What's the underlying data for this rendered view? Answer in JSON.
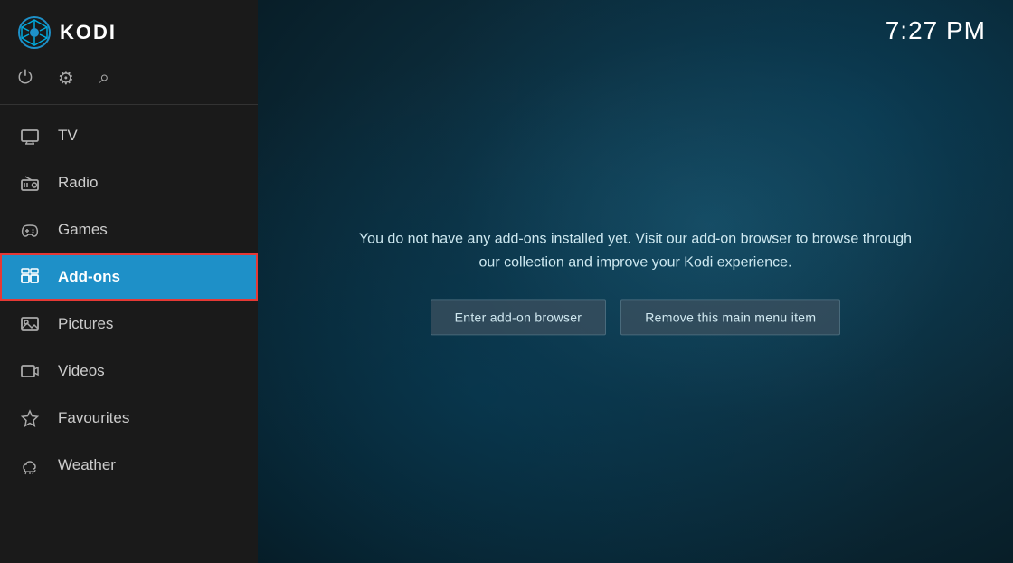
{
  "app": {
    "title": "KODI",
    "clock": "7:27 PM"
  },
  "sidebar": {
    "icons": [
      {
        "name": "power-icon",
        "symbol": "⏻",
        "label": "Power"
      },
      {
        "name": "settings-icon",
        "symbol": "⚙",
        "label": "Settings"
      },
      {
        "name": "search-icon",
        "symbol": "⌕",
        "label": "Search"
      }
    ],
    "nav_items": [
      {
        "id": "tv",
        "label": "TV",
        "icon": "tv-icon",
        "active": false
      },
      {
        "id": "radio",
        "label": "Radio",
        "icon": "radio-icon",
        "active": false
      },
      {
        "id": "games",
        "label": "Games",
        "icon": "games-icon",
        "active": false
      },
      {
        "id": "addons",
        "label": "Add-ons",
        "icon": "addons-icon",
        "active": true
      },
      {
        "id": "pictures",
        "label": "Pictures",
        "icon": "pictures-icon",
        "active": false
      },
      {
        "id": "videos",
        "label": "Videos",
        "icon": "videos-icon",
        "active": false
      },
      {
        "id": "favourites",
        "label": "Favourites",
        "icon": "favourites-icon",
        "active": false
      },
      {
        "id": "weather",
        "label": "Weather",
        "icon": "weather-icon",
        "active": false
      }
    ]
  },
  "main": {
    "message_line1": "You do not have any add-ons installed yet. Visit our add-on browser to browse through",
    "message_line2": "our collection and improve your Kodi experience.",
    "button_browser": "Enter add-on browser",
    "button_remove": "Remove this main menu item"
  }
}
